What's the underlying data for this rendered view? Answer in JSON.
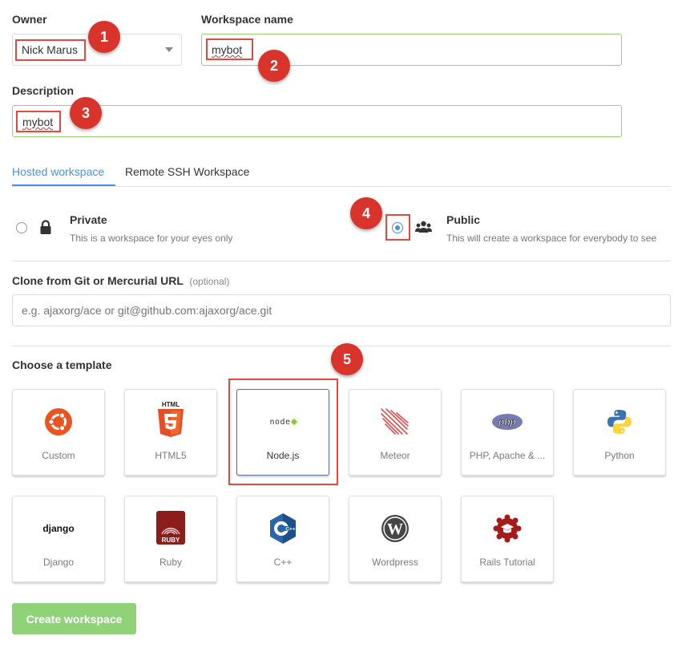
{
  "owner": {
    "label": "Owner",
    "value": "Nick Marus"
  },
  "workspace_name": {
    "label": "Workspace name",
    "value": "mybot"
  },
  "description": {
    "label": "Description",
    "value": "mybot"
  },
  "tabs": [
    {
      "label": "Hosted workspace",
      "active": true
    },
    {
      "label": "Remote SSH Workspace",
      "active": false
    }
  ],
  "privacy": {
    "private": {
      "title": "Private",
      "subtitle": "This is a workspace for your eyes only",
      "selected": false,
      "icon": "lock-icon"
    },
    "public": {
      "title": "Public",
      "subtitle": "This will create a workspace for everybody to see",
      "selected": true,
      "icon": "users-icon"
    }
  },
  "clone": {
    "label": "Clone from Git or Mercurial URL",
    "optional": "(optional)",
    "placeholder": "e.g. ajaxorg/ace or git@github.com:ajaxorg/ace.git"
  },
  "templates": {
    "heading": "Choose a template",
    "items": [
      {
        "name": "Custom",
        "icon": "ubuntu-icon"
      },
      {
        "name": "HTML5",
        "icon": "html5-icon",
        "logo_text": "HTML"
      },
      {
        "name": "Node.js",
        "icon": "nodejs-icon",
        "logo_text": "node",
        "selected": true
      },
      {
        "name": "Meteor",
        "icon": "meteor-icon"
      },
      {
        "name": "PHP, Apache & ...",
        "icon": "php-icon",
        "logo_text": "php"
      },
      {
        "name": "Python",
        "icon": "python-icon"
      },
      {
        "name": "Django",
        "icon": "django-icon",
        "logo_text": "django"
      },
      {
        "name": "Ruby",
        "icon": "ruby-icon",
        "logo_text": "RUBY"
      },
      {
        "name": "C++",
        "icon": "cpp-icon",
        "logo_text": "C++"
      },
      {
        "name": "Wordpress",
        "icon": "wordpress-icon",
        "logo_text": "W"
      },
      {
        "name": "Rails Tutorial",
        "icon": "rails-tutorial-icon"
      }
    ]
  },
  "create_button": "Create workspace",
  "callouts": [
    "1",
    "2",
    "3",
    "4",
    "5"
  ],
  "colors": {
    "accent": "#4a90e2",
    "valid_border": "#9bd16d",
    "button": "#8fd277",
    "callout": "#d9342b"
  }
}
